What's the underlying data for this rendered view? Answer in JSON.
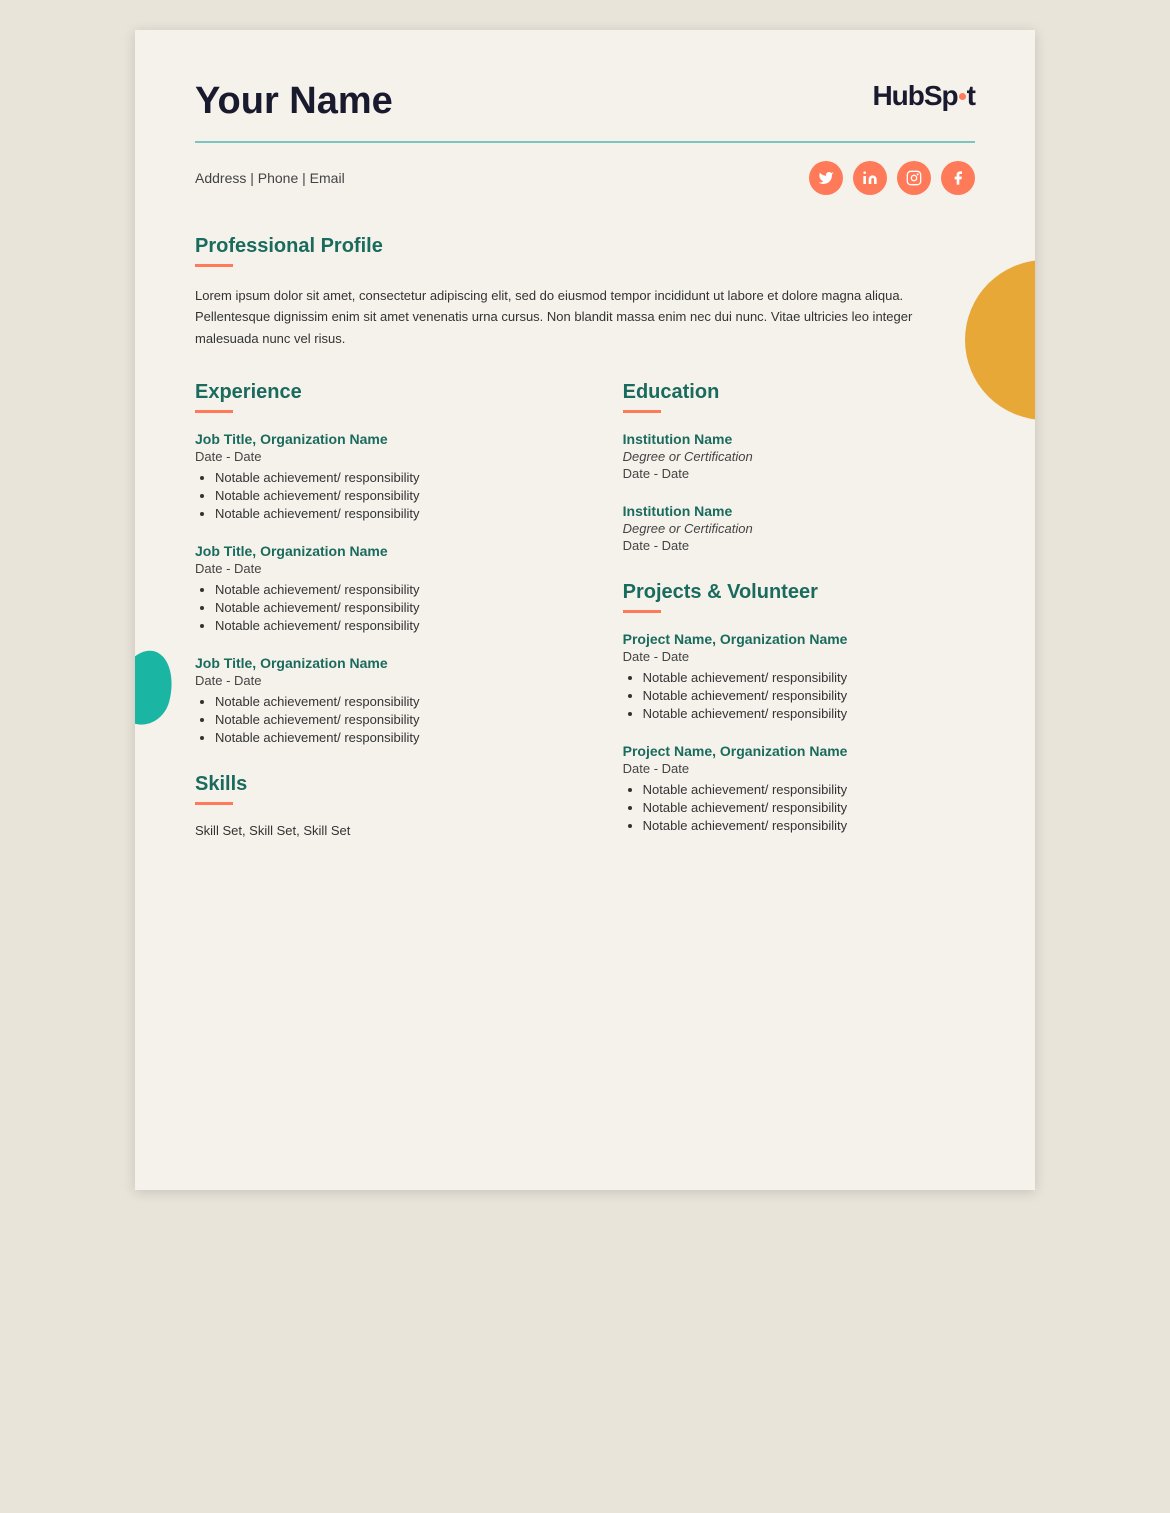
{
  "header": {
    "name": "Your Name",
    "logo_text_hub": "HubSp",
    "logo_text_ot": "t",
    "logo_dot": "·"
  },
  "contact": {
    "text": "Address  |  Phone  |  Email"
  },
  "social": {
    "icons": [
      "twitter",
      "linkedin",
      "instagram",
      "facebook"
    ]
  },
  "profile": {
    "heading": "Professional Profile",
    "body": "Lorem ipsum dolor sit amet, consectetur adipiscing elit, sed do eiusmod tempor incididunt ut labore et dolore magna aliqua. Pellentesque dignissim enim sit amet venenatis urna cursus. Non blandit massa enim nec dui nunc. Vitae ultricies leo integer malesuada nunc vel risus."
  },
  "experience": {
    "heading": "Experience",
    "entries": [
      {
        "title": "Job Title, Organization Name",
        "date": "Date - Date",
        "achievements": [
          "Notable achievement/ responsibility",
          "Notable achievement/ responsibility",
          "Notable achievement/ responsibility"
        ]
      },
      {
        "title": "Job Title, Organization Name",
        "date": "Date - Date",
        "achievements": [
          "Notable achievement/ responsibility",
          "Notable achievement/ responsibility",
          "Notable achievement/ responsibility"
        ]
      },
      {
        "title": "Job Title, Organization Name",
        "date": "Date - Date",
        "achievements": [
          "Notable achievement/ responsibility",
          "Notable achievement/ responsibility",
          "Notable achievement/ responsibility"
        ]
      }
    ]
  },
  "education": {
    "heading": "Education",
    "entries": [
      {
        "institution": "Institution Name",
        "degree": "Degree or Certification",
        "date": "Date - Date"
      },
      {
        "institution": "Institution Name",
        "degree": "Degree or Certification",
        "date": "Date - Date"
      }
    ]
  },
  "skills": {
    "heading": "Skills",
    "text": "Skill Set, Skill Set, Skill Set"
  },
  "projects": {
    "heading": "Projects & Volunteer",
    "entries": [
      {
        "title": "Project Name, Organization Name",
        "date": "Date - Date",
        "achievements": [
          "Notable achievement/ responsibility",
          "Notable achievement/ responsibility",
          "Notable achievement/ responsibility"
        ]
      },
      {
        "title": "Project Name, Organization Name",
        "date": "Date - Date",
        "achievements": [
          "Notable achievement/ responsibility",
          "Notable achievement/ responsibility",
          "Notable achievement/ responsibility"
        ]
      }
    ]
  }
}
